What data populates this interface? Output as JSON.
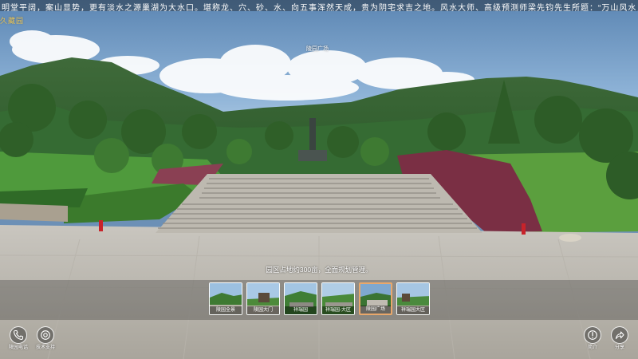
{
  "ticker": {
    "text": "明堂平阔，案山显势，更有淡水之源巢湖为大水口。堪称龙、穴、砂、水、向五事浑然天成，贵为阴宅求吉之地。风水大师、高级预测师梁先钧先生所题：“万山风水，阴宅品牌。藏风聚气，荫福后"
  },
  "logo": {
    "text": "久藏园"
  },
  "hotspot": {
    "label": "陵园广场"
  },
  "caption": {
    "text": "园区占地约300亩，全面规划管理。"
  },
  "thumbnails": [
    {
      "label": "陵园全景",
      "active": false
    },
    {
      "label": "陵园大门",
      "active": false
    },
    {
      "label": "祥瑞园",
      "active": false
    },
    {
      "label": "祥瑞园-大区",
      "active": false
    },
    {
      "label": "陵园广场",
      "active": true
    },
    {
      "label": "祥瑞园大区",
      "active": false
    }
  ],
  "buttons": {
    "phone_label": "陵园电话",
    "tech_label": "技术支持",
    "intro_label": "简介",
    "share_label": "分享"
  },
  "colors": {
    "active_border": "#e9a86b",
    "ticker_bg": "#37475a",
    "logo": "#e8c45a"
  },
  "icons": {
    "phone": "phone-icon",
    "tech": "support-icon",
    "intro": "info-icon",
    "share": "share-icon"
  }
}
